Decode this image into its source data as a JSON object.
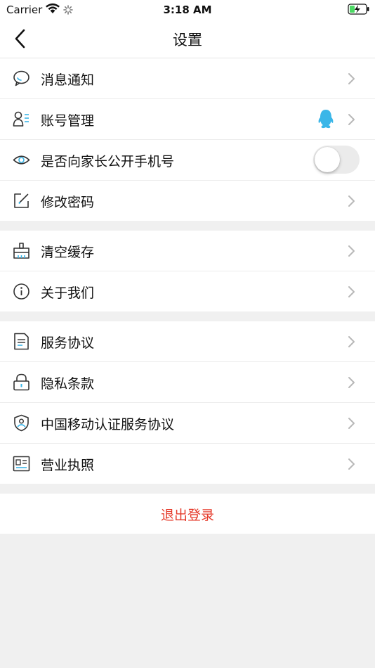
{
  "status_bar": {
    "carrier": "Carrier",
    "time": "3:18 AM"
  },
  "nav": {
    "title": "设置"
  },
  "settings": {
    "notifications": "消息通知",
    "account": "账号管理",
    "phone_public": "是否向家长公开手机号",
    "change_password": "修改密码",
    "clear_cache": "清空缓存",
    "about": "关于我们",
    "service_agreement": "服务协议",
    "privacy": "隐私条款",
    "cmcc_agreement": "中国移动认证服务协议",
    "business_license": "营业执照"
  },
  "phone_public_enabled": false,
  "logout": {
    "label": "退出登录",
    "color": "#e53a2a"
  },
  "colors": {
    "accent": "#3ab6e8",
    "background": "#f0f0f0"
  }
}
